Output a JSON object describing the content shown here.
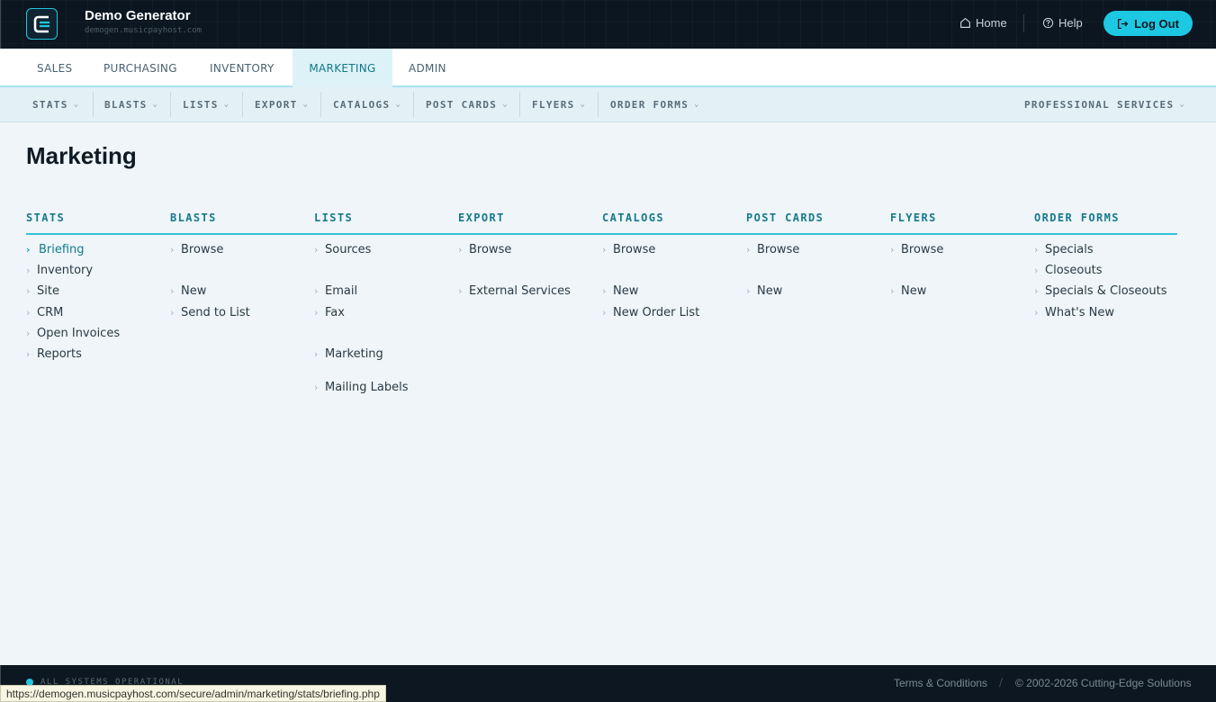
{
  "header": {
    "title": "Demo Generator",
    "subtitle": "demogen.musicpayhost.com",
    "home_label": "Home",
    "help_label": "Help",
    "logout_label": "Log Out"
  },
  "tabs": [
    {
      "label": "SALES"
    },
    {
      "label": "PURCHASING"
    },
    {
      "label": "INVENTORY"
    },
    {
      "label": "MARKETING",
      "active": true
    },
    {
      "label": "ADMIN"
    }
  ],
  "subnav": {
    "items": [
      {
        "label": "STATS"
      },
      {
        "label": "BLASTS"
      },
      {
        "label": "LISTS"
      },
      {
        "label": "EXPORT"
      },
      {
        "label": "CATALOGS"
      },
      {
        "label": "POST CARDS"
      },
      {
        "label": "FLYERS"
      },
      {
        "label": "ORDER FORMS"
      }
    ],
    "right_item": "PROFESSIONAL SERVICES",
    "caret": "⌄"
  },
  "page": {
    "title": "Marketing"
  },
  "columns": [
    {
      "heading": "STATS",
      "links": [
        "Briefing",
        "Inventory",
        "Site",
        "CRM",
        "Open Invoices",
        "Reports"
      ]
    },
    {
      "heading": "BLASTS",
      "links": [
        "Browse",
        "New",
        "Send to List"
      ]
    },
    {
      "heading": "LISTS",
      "links": [
        "Sources",
        "Email",
        "Fax",
        "Marketing",
        "Mailing Labels"
      ]
    },
    {
      "heading": "EXPORT",
      "links": [
        "Browse",
        "External Services"
      ]
    },
    {
      "heading": "CATALOGS",
      "links": [
        "Browse",
        "New",
        "New Order List"
      ]
    },
    {
      "heading": "POST CARDS",
      "links": [
        "Browse",
        "New"
      ]
    },
    {
      "heading": "FLYERS",
      "links": [
        "Browse",
        "New"
      ]
    },
    {
      "heading": "ORDER FORMS",
      "links": [
        "Specials",
        "Closeouts",
        "Specials & Closeouts",
        "What's New"
      ]
    }
  ],
  "footer": {
    "status": "ALL SYSTEMS OPERATIONAL",
    "terms": "Terms & Conditions",
    "separator": "/",
    "copyright": "© 2002-2026 Cutting-Edge Solutions"
  },
  "browser_status_url": "https://demogen.musicpayhost.com/secure/admin/marketing/stats/briefing.php",
  "colors": {
    "accent": "#1cc8e2",
    "header_bg": "#0b1620",
    "heading": "#167a8c",
    "page_bg": "#eff5f8"
  },
  "icons": {
    "chevron": "›",
    "home": "home-icon",
    "help": "help-icon",
    "logout": "logout-icon"
  }
}
